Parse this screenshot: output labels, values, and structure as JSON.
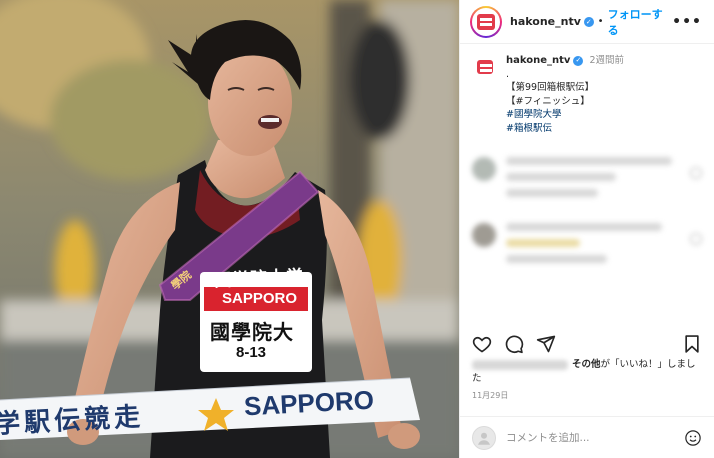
{
  "account": {
    "username": "hakone_ntv",
    "dot": "•",
    "follow_label": "フォローする",
    "more_label": "•••"
  },
  "caption": {
    "username": "hakone_ntv",
    "time": "2週間前",
    "lines": [
      ".",
      "【第99回箱根駅伝】",
      "【#フィニッシュ】"
    ],
    "hashtags": [
      "#國學院大學",
      "#箱根駅伝"
    ]
  },
  "photo": {
    "bib_school": "國學院大",
    "bib_number": "8-13",
    "bib_sponsor": "SAPPORO",
    "jersey_text": "國学院大学",
    "tape_text": "学駅伝競走",
    "tape_sponsor": "SAPPORO",
    "sash_text": "學院",
    "colors": {
      "tape": "#f4f6f8",
      "star": "#f0b12a",
      "sponsor_red": "#d9232e",
      "sash": "#7a3a8a",
      "singlet": "#1b1b1d"
    }
  },
  "likes": {
    "text_mid": "その他",
    "text_rest": "が「いいね！」しました"
  },
  "post_date": "11月29日",
  "comment": {
    "placeholder": "コメントを追加..."
  },
  "accent": {
    "link": "#0095f6",
    "verified": "#3897f0",
    "hashtag": "#00376b"
  }
}
